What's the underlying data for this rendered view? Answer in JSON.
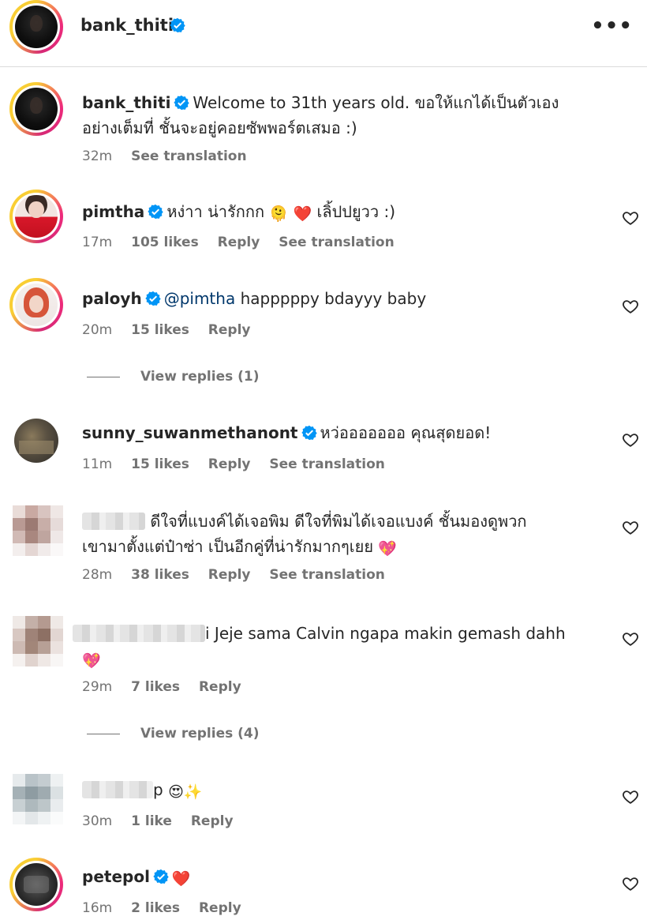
{
  "header": {
    "username": "bank_thiti",
    "more_icon": "more-horizontal-icon"
  },
  "caption": {
    "username": "bank_thiti",
    "text_line1": "Welcome to 31th years old. ขอให้แกได้เป็นตัวเอง",
    "text_line2": "อย่างเต็มที่ ชั้นจะอยู่คอยซัพพอร์ตเสมอ :)",
    "time": "32m",
    "see_translation": "See translation"
  },
  "comments": [
    {
      "username": "pimtha",
      "text": "หง่าา น่ารักกก",
      "text_after": "เลิ้ปปยูวว :)",
      "time": "17m",
      "likes": "105 likes",
      "reply": "Reply",
      "see_translation": "See translation"
    },
    {
      "username": "paloyh",
      "mention": "@pimtha",
      "text": "happpppy bdayyy baby",
      "time": "20m",
      "likes": "15 likes",
      "reply": "Reply",
      "view_replies": "View replies (1)"
    },
    {
      "username": "sunny_suwanmethanont",
      "text": "หว่อออออออ คุณสุดยอด!",
      "time": "11m",
      "likes": "15 likes",
      "reply": "Reply",
      "see_translation": "See translation"
    },
    {
      "text_line1": "ดีใจที่แบงค์ได้เจอพิม ดีใจที่พิมได้เจอแบงค์ ชั้นมองดูพวก",
      "text_line2": "เขามาตั้งแต่ป๋าซ่า เป็นอีกคู่ที่น่ารักมากๆเยย",
      "time": "28m",
      "likes": "38 likes",
      "reply": "Reply",
      "see_translation": "See translation"
    },
    {
      "text": "i Jeje sama Calvin ngapa makin gemash dahh",
      "time": "29m",
      "likes": "7 likes",
      "reply": "Reply",
      "view_replies": "View replies (4)"
    },
    {
      "text": "p",
      "time": "30m",
      "likes": "1 like",
      "reply": "Reply"
    },
    {
      "username": "petepol",
      "time": "16m",
      "likes": "2 likes",
      "reply": "Reply"
    }
  ],
  "emojis": {
    "hug": "🫠",
    "red_heart": "❤️",
    "sparkle_heart": "💖",
    "heart_eyes": "😍",
    "sparkles": "✨"
  },
  "colors": {
    "verified": "#0095f6",
    "text": "#262626",
    "muted": "#737373",
    "mention": "#00376b"
  }
}
